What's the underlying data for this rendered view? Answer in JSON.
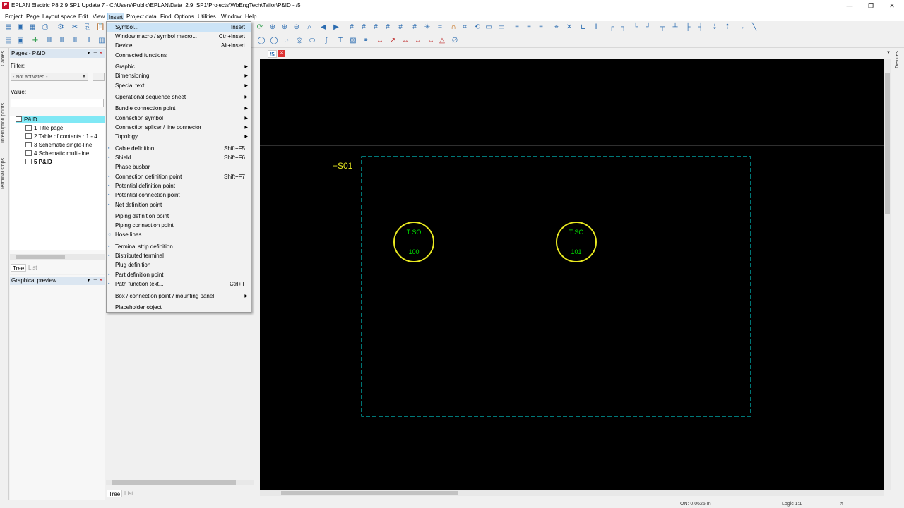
{
  "window": {
    "title": "EPLAN Electric P8 2.9 SP1 Update 7 - C:\\Users\\Public\\EPLAN\\Data_2.9_SP1\\Projects\\WbEngTech\\Tailor\\P&ID - /5",
    "app_icon_glyph": "E",
    "minimize_glyph": "—",
    "restore_glyph": "❐",
    "close_glyph": "✕"
  },
  "menubar": {
    "items": [
      "Project",
      "Page",
      "Layout space",
      "Edit",
      "View",
      "Insert",
      "Project data",
      "Find",
      "Options",
      "Utilities",
      "Window",
      "Help"
    ],
    "active_index": 5
  },
  "left_strip": {
    "labels": [
      "Cables",
      "Interruption points",
      "Terminal strips"
    ]
  },
  "right_strip": {
    "labels": [
      "Devices"
    ]
  },
  "pages_panel": {
    "title": "Pages - P&ID",
    "filter_label": "Filter:",
    "filter_value": "- Not activated -",
    "value_label": "Value:",
    "tree": [
      {
        "label": "P&ID",
        "selected": true
      },
      {
        "label": "1 Title page"
      },
      {
        "label": "2 Table of contents : 1 - 4"
      },
      {
        "label": "3 Schematic single-line"
      },
      {
        "label": "4 Schematic multi-line"
      },
      {
        "label": "5 P&ID",
        "bold": true
      }
    ],
    "tabs": [
      "Tree",
      "List"
    ]
  },
  "preview_panel": {
    "title": "Graphical preview"
  },
  "bg_panel": {
    "tabs": [
      "Tree",
      "List"
    ]
  },
  "canvas": {
    "page_tab": "/5",
    "location_label": "+S01",
    "symbols": [
      {
        "top": "T SO",
        "bottom": "100"
      },
      {
        "top": "T SO",
        "bottom": "101"
      }
    ]
  },
  "insert_menu": {
    "items": [
      {
        "label": "Symbol...",
        "shortcut": "Insert"
      },
      {
        "label": "Window macro / symbol macro...",
        "shortcut": "Ctrl+Insert"
      },
      {
        "label": "Device...",
        "shortcut": "Alt+Insert"
      },
      {
        "label": "Connected functions"
      },
      {
        "label": "Graphic",
        "submenu": true
      },
      {
        "label": "Dimensioning",
        "submenu": true
      },
      {
        "label": "Special text",
        "submenu": true
      },
      {
        "label": "Operational sequence sheet",
        "submenu": true
      },
      {
        "label": "Bundle connection point",
        "submenu": true
      },
      {
        "label": "Connection symbol",
        "submenu": true
      },
      {
        "label": "Connection splicer / line connector",
        "submenu": true
      },
      {
        "label": "Topology",
        "submenu": true
      },
      {
        "label": "Cable definition",
        "shortcut": "Shift+F5"
      },
      {
        "label": "Shield",
        "shortcut": "Shift+F6"
      },
      {
        "label": "Phase busbar"
      },
      {
        "label": "Connection definition point",
        "shortcut": "Shift+F7"
      },
      {
        "label": "Potential definition point"
      },
      {
        "label": "Potential connection point"
      },
      {
        "label": "Net definition point"
      },
      {
        "label": "Piping definition point"
      },
      {
        "label": "Piping connection point"
      },
      {
        "label": "Hose lines"
      },
      {
        "label": "Terminal strip definition"
      },
      {
        "label": "Distributed terminal"
      },
      {
        "label": "Plug definition"
      },
      {
        "label": "Part definition point"
      },
      {
        "label": "Path function text...",
        "shortcut": "Ctrl+T"
      },
      {
        "label": "Box / connection point / mounting panel",
        "submenu": true
      },
      {
        "label": "Placeholder object"
      }
    ]
  },
  "statusbar": {
    "coords": "ON: 0.0625 In",
    "logic": "Logic 1:1",
    "grid": "#"
  },
  "colors": {
    "canvas_bg": "#000000",
    "border_dash": "#00c0c0",
    "symbol_circle": "#e8e820",
    "symbol_text": "#00e000",
    "location_text": "#e8e820"
  }
}
